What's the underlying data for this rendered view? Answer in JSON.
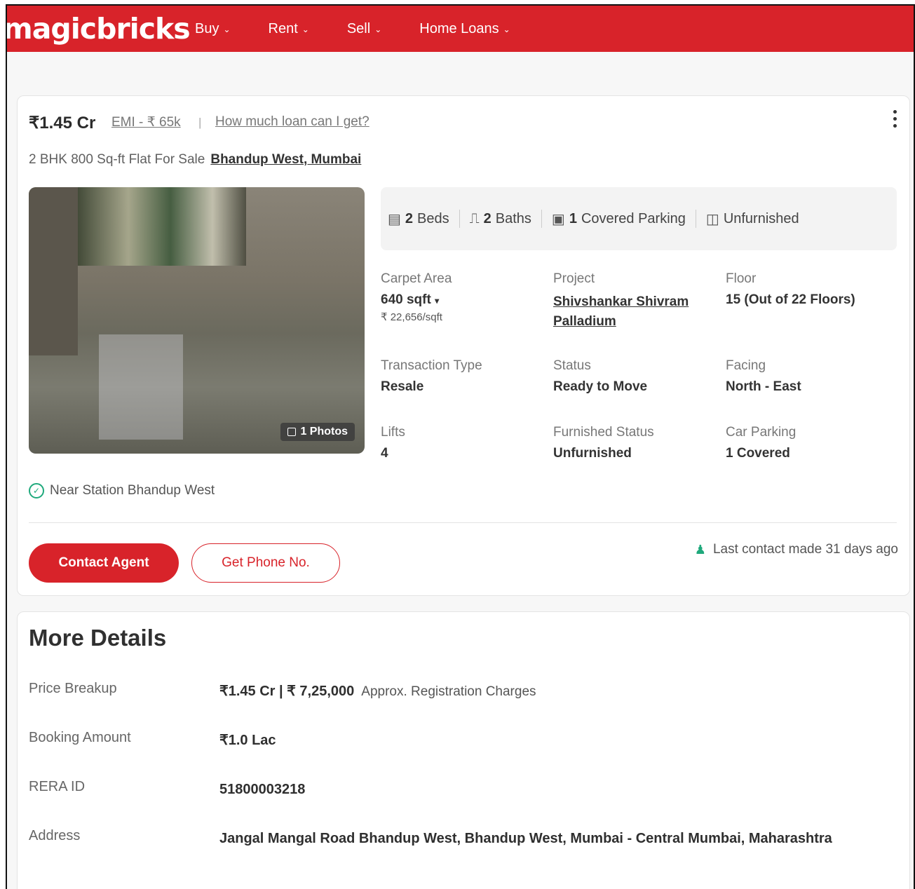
{
  "header": {
    "logo": "magicbricks",
    "nav": [
      {
        "label": "Buy"
      },
      {
        "label": "Rent"
      },
      {
        "label": "Sell"
      },
      {
        "label": "Home Loans"
      }
    ]
  },
  "listing": {
    "price": "₹1.45 Cr",
    "emi": "EMI - ₹ 65k",
    "separator": "|",
    "loan_link": "How much loan can I get?",
    "title": "2 BHK 800 Sq-ft Flat For Sale",
    "location": "Bhandup West, Mumbai",
    "photos_badge": "1 Photos",
    "amenities": [
      {
        "icon": "bed-icon",
        "bold": "2",
        "text": "Beds"
      },
      {
        "icon": "bath-icon",
        "bold": "2",
        "text": "Baths"
      },
      {
        "icon": "car-icon",
        "bold": "1",
        "text": "Covered Parking"
      },
      {
        "icon": "furniture-icon",
        "bold": "",
        "text": "Unfurnished"
      }
    ],
    "details": {
      "carpet_area": {
        "label": "Carpet Area",
        "value": "640 sqft",
        "sub": "₹ 22,656/sqft"
      },
      "project": {
        "label": "Project",
        "value": "Shivshankar Shivram Palladium"
      },
      "floor": {
        "label": "Floor",
        "value": "15 (Out of 22 Floors)"
      },
      "transaction": {
        "label": "Transaction Type",
        "value": "Resale"
      },
      "status": {
        "label": "Status",
        "value": "Ready to Move"
      },
      "facing": {
        "label": "Facing",
        "value": "North - East"
      },
      "lifts": {
        "label": "Lifts",
        "value": "4"
      },
      "furnished": {
        "label": "Furnished Status",
        "value": "Unfurnished"
      },
      "car_parking": {
        "label": "Car Parking",
        "value": "1 Covered"
      }
    },
    "near": "Near Station Bhandup West",
    "contact_button": "Contact Agent",
    "phone_button": "Get Phone No.",
    "last_contact": "Last contact made 31 days ago"
  },
  "more_details": {
    "title": "More Details",
    "rows": [
      {
        "key": "Price Breakup",
        "value": "₹1.45 Cr | ₹ 7,25,000",
        "note": "Approx. Registration Charges"
      },
      {
        "key": "Booking Amount",
        "value": "₹1.0 Lac"
      },
      {
        "key": "RERA ID",
        "value": "51800003218"
      },
      {
        "key": "Address",
        "value": "Jangal Mangal Road Bhandup West, Bhandup West, Mumbai - Central Mumbai, Maharashtra"
      }
    ]
  },
  "colors": {
    "brand": "#d8232a",
    "success": "#1fa97c"
  }
}
